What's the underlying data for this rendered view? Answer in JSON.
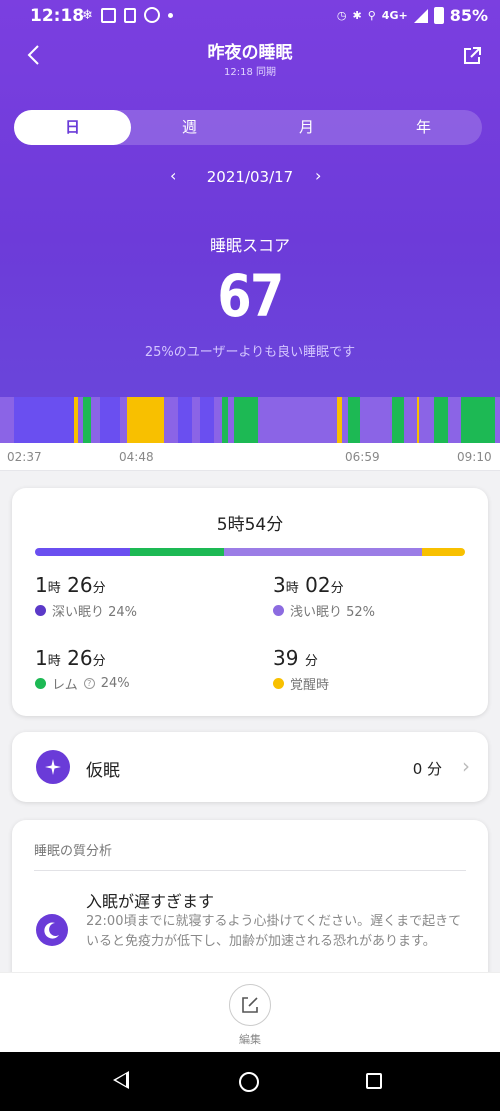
{
  "status": {
    "time": "12:18",
    "battery": "85%",
    "network": "4G+"
  },
  "header": {
    "title": "昨夜の睡眠",
    "sync": "12:18 同期"
  },
  "tabs": [
    "日",
    "週",
    "月",
    "年"
  ],
  "active_tab": "日",
  "date": "2021/03/17",
  "score": {
    "label": "睡眠スコア",
    "value": "67",
    "desc": "25%のユーザーよりも良い睡眠です"
  },
  "timeline": {
    "labels": [
      "02:37",
      "04:48",
      "06:59",
      "09:10"
    ]
  },
  "summary": {
    "total": "5時54分",
    "deep": {
      "h": "1",
      "m": "26",
      "label": "深い眠り 24%",
      "color": "#5b39c8"
    },
    "light": {
      "h": "3",
      "m": "02",
      "label": "浅い眠り 52%",
      "color": "#8c6be0"
    },
    "rem": {
      "h": "1",
      "m": "26",
      "label": "レム",
      "pct": "24%",
      "color": "#1db954"
    },
    "awake": {
      "m": "39",
      "label": "覚醒時",
      "color": "#f8c000"
    },
    "unit_h": "時",
    "unit_m": "分"
  },
  "nap": {
    "label": "仮眠",
    "value": "0 分"
  },
  "analysis": {
    "title": "睡眠の質分析",
    "heading": "入眠が遅すぎます",
    "body": "22:00頃までに就寝するよう心掛けてください。遅くまで起きていると免疫力が低下し、加齢が加速される恐れがあります。"
  },
  "bottom": {
    "edit_label": "編集"
  }
}
